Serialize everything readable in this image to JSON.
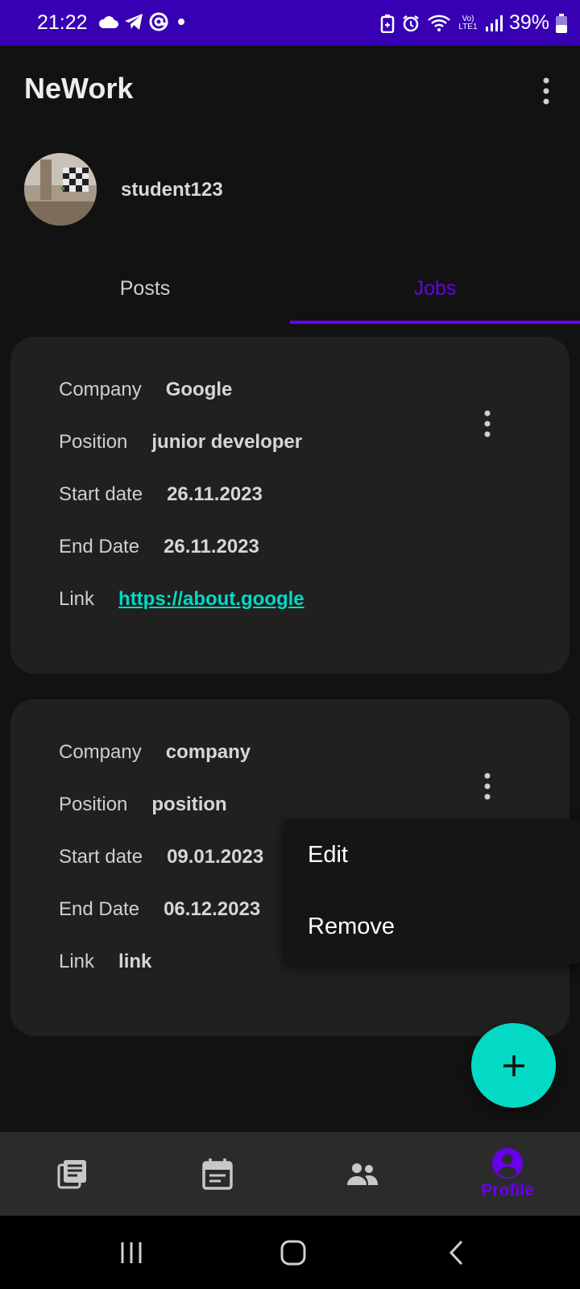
{
  "status_bar": {
    "time": "21:22",
    "battery": "39%",
    "network_label": "Vo) LTE1",
    "left_icons": [
      "cloud-icon",
      "telegram-icon",
      "at-icon",
      "dot-icon"
    ],
    "right_icons": [
      "battery-saver-icon",
      "alarm-icon",
      "wifi-icon",
      "signal-icon",
      "battery-icon"
    ]
  },
  "app_bar": {
    "title": "NeWork",
    "menu_icon": "more-vert-icon"
  },
  "profile": {
    "username": "student123"
  },
  "tabs": [
    {
      "label": "Posts",
      "selected": false
    },
    {
      "label": "Jobs",
      "selected": true
    }
  ],
  "labels": {
    "company": "Company",
    "position": "Position",
    "start_date": "Start date",
    "end_date": "End Date",
    "link": "Link"
  },
  "jobs": [
    {
      "company": "Google",
      "position": "junior developer",
      "start_date": "26.11.2023",
      "end_date": "26.11.2023",
      "link": "https://about.google"
    },
    {
      "company": "company",
      "position": "position",
      "start_date": "09.01.2023",
      "end_date": "06.12.2023",
      "link": "link"
    }
  ],
  "popup_menu": {
    "items": [
      "Edit",
      "Remove"
    ]
  },
  "fab": {
    "icon": "plus-icon"
  },
  "bottom_nav": {
    "items": [
      {
        "icon": "feed-icon",
        "label": "",
        "selected": false
      },
      {
        "icon": "event-icon",
        "label": "",
        "selected": false
      },
      {
        "icon": "people-icon",
        "label": "",
        "selected": false
      },
      {
        "icon": "profile-icon",
        "label": "Profile",
        "selected": true
      }
    ]
  },
  "colors": {
    "primary": "#6a00ee",
    "status_bar": "#3700b3",
    "accent": "#03dac5",
    "background": "#121212",
    "card": "#202020"
  }
}
